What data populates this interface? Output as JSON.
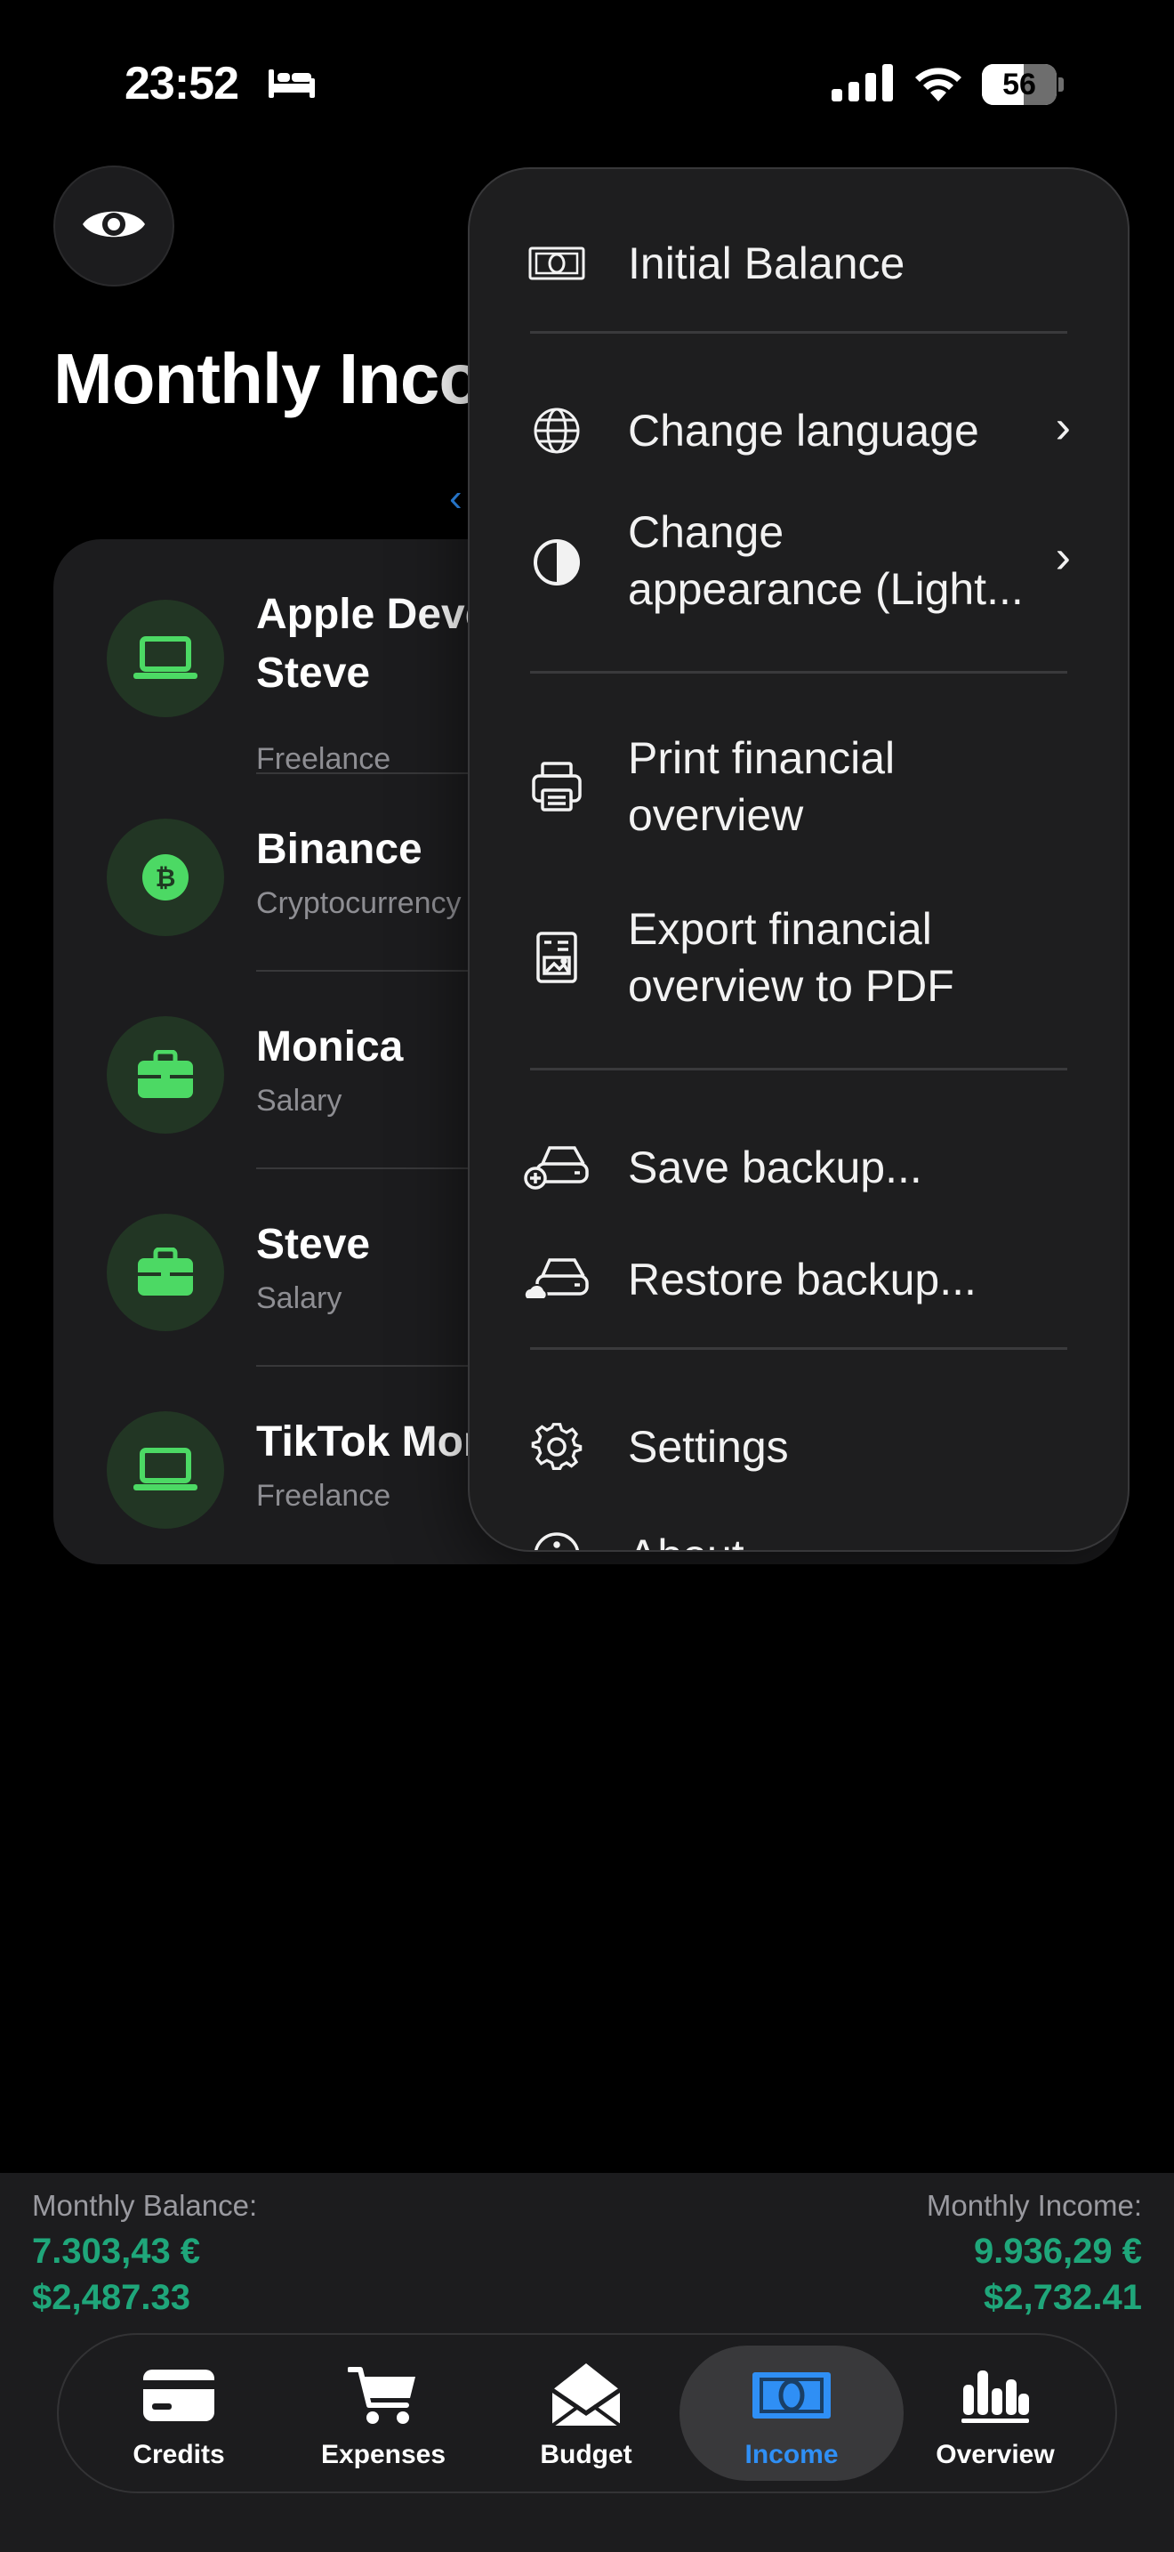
{
  "status_bar": {
    "time": "23:52",
    "battery_level": "56",
    "battery_fraction": 0.56,
    "icons": [
      "bed-icon",
      "cellular-signal-icon",
      "wifi-icon",
      "battery-icon"
    ]
  },
  "header": {
    "title": "Monthly Income",
    "visibility_icon": "eye-icon",
    "prev_icon": "chevron-left-icon"
  },
  "income_list": [
    {
      "name": "Apple Developer\nSteve",
      "category": "Freelance",
      "icon": "laptop-icon"
    },
    {
      "name": "Binance",
      "category": "Cryptocurrency",
      "icon": "bitcoin-icon"
    },
    {
      "name": "Monica",
      "category": "Salary",
      "icon": "briefcase-icon"
    },
    {
      "name": "Steve",
      "category": "Salary",
      "icon": "briefcase-icon"
    },
    {
      "name": "TikTok Monetization",
      "category": "Freelance",
      "icon": "laptop-icon"
    }
  ],
  "menu": {
    "items": [
      {
        "label": "Initial Balance",
        "icon": "banknote-icon"
      },
      {
        "label": "Change language",
        "icon": "globe-icon",
        "submenu": true
      },
      {
        "label": "Change\nappearance (Light...",
        "icon": "contrast-icon",
        "submenu": true
      },
      {
        "label": "Print financial\noverview",
        "icon": "printer-icon"
      },
      {
        "label": "Export financial\noverview to PDF",
        "icon": "document-image-icon"
      },
      {
        "label": "Save backup...",
        "icon": "drive-add-icon"
      },
      {
        "label": "Restore backup...",
        "icon": "drive-cloud-icon"
      },
      {
        "label": "Settings",
        "icon": "gear-icon"
      },
      {
        "label": "About",
        "icon": "info-icon"
      }
    ]
  },
  "summary": {
    "balance_label": "Monthly Balance:",
    "balance_eur": "7.303,43 €",
    "balance_usd": "$2,487.33",
    "income_label": "Monthly Income:",
    "income_eur": "9.936,29 €",
    "income_usd": "$2,732.41"
  },
  "tabs": [
    {
      "label": "Credits",
      "icon": "credit-card-icon"
    },
    {
      "label": "Expenses",
      "icon": "cart-icon"
    },
    {
      "label": "Budget",
      "icon": "envelope-icon"
    },
    {
      "label": "Income",
      "icon": "banknote-icon",
      "active": true
    },
    {
      "label": "Overview",
      "icon": "bar-chart-icon"
    }
  ],
  "colors": {
    "accent_blue": "#2f8ff5",
    "money_green": "#1fa67a",
    "icon_green": "#4cd964",
    "background": "#000000",
    "card": "#1c1c1e"
  }
}
